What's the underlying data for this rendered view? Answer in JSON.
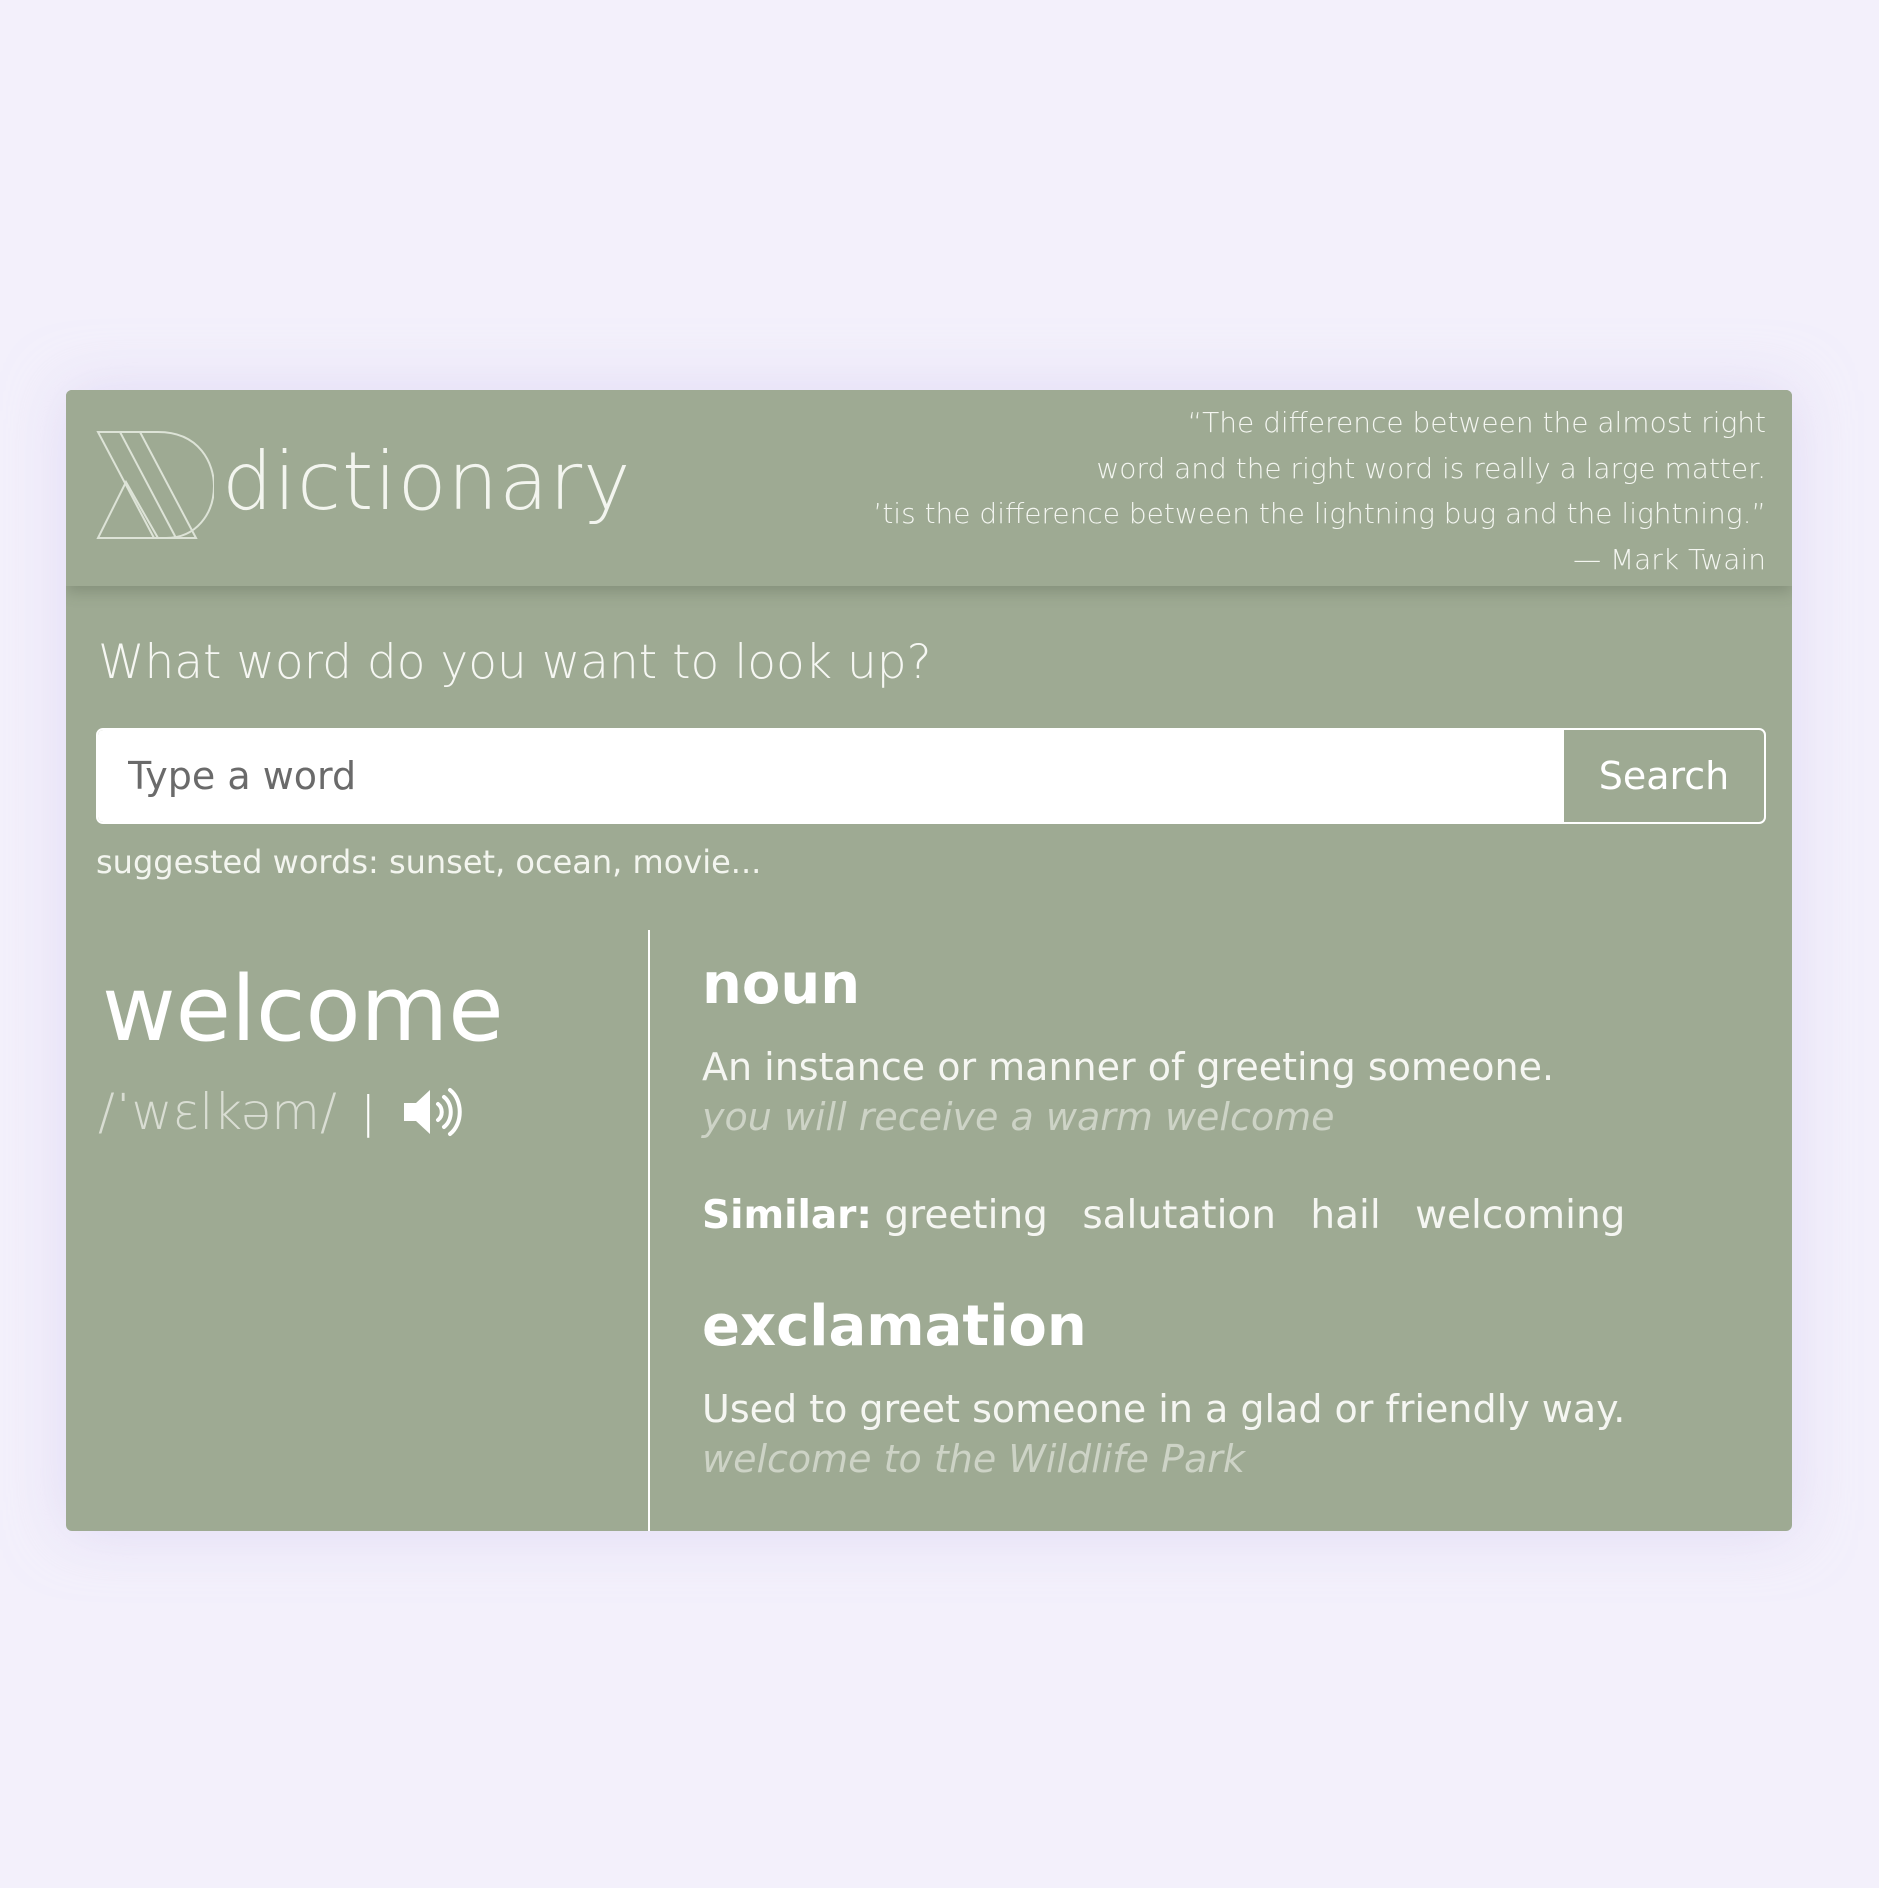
{
  "header": {
    "brand": "dictionary",
    "quote": {
      "lines": [
        "“The difference between the almost right",
        "word and the right word is really a large matter.",
        "’tis the difference between the lightning bug and the lightning.”",
        "— Mark Twain"
      ]
    }
  },
  "search": {
    "prompt": "What word do you want to look up?",
    "placeholder": "Type a word",
    "value": "",
    "button_label": "Search",
    "suggested": "suggested words: sunset, ocean, movie..."
  },
  "entry": {
    "word": "welcome",
    "phonetic": "/ˈwɛlkəm/",
    "separator": "|",
    "meanings": [
      {
        "part_of_speech": "noun",
        "definition": "An instance or manner of greeting someone.",
        "example": "you will receive a warm welcome",
        "similar_label": "Similar:",
        "synonyms": [
          "greeting",
          "salutation",
          "hail",
          "welcoming"
        ]
      },
      {
        "part_of_speech": "exclamation",
        "definition": "Used to greet someone in a glad or friendly way.",
        "example": "welcome to the Wildlife Park"
      }
    ]
  },
  "icons": {
    "logo": "dictionary-logo-icon",
    "audio": "speaker-icon"
  },
  "colors": {
    "page_background": "#f3f0fb",
    "card": "#9eaa93",
    "text": "#ffffff",
    "example_text": "#cdd3c6"
  }
}
